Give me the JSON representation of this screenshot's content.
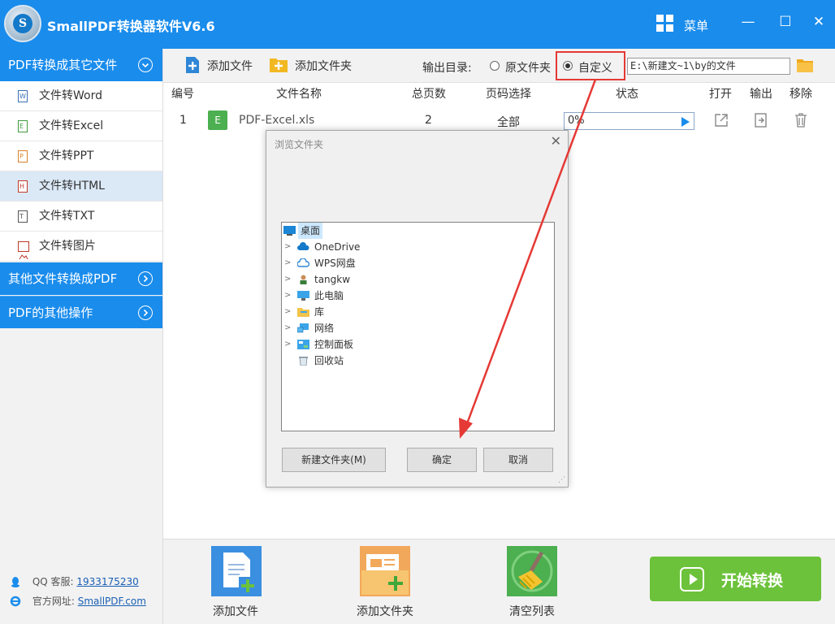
{
  "app": {
    "logo_letter": "S",
    "title": "SmallPDF转换器软件V6.6",
    "menu_label": "菜单",
    "window_controls": {
      "minimize": "—",
      "maximize": "☐",
      "close": "✕"
    }
  },
  "sidebar": {
    "group_main": "PDF转换成其它文件",
    "items": [
      {
        "label": "文件转Word",
        "icon_letter": "W",
        "active": false
      },
      {
        "label": "文件转Excel",
        "icon_letter": "E",
        "active": false
      },
      {
        "label": "文件转PPT",
        "icon_letter": "P",
        "active": false
      },
      {
        "label": "文件转HTML",
        "icon_letter": "H",
        "active": true
      },
      {
        "label": "文件转TXT",
        "icon_letter": "T",
        "active": false
      },
      {
        "label": "文件转图片",
        "icon_letter": "",
        "active": false
      }
    ],
    "group_other": "其他文件转换成PDF",
    "group_ops": "PDF的其他操作",
    "contact": {
      "qq_label": "QQ 客服:",
      "qq_value": "1933175230",
      "site_label": "官方网址:",
      "site_value": "SmallPDF.com"
    }
  },
  "toolbar": {
    "add_file": "添加文件",
    "add_folder": "添加文件夹",
    "output_label": "输出目录:",
    "option_source": "原文件夹",
    "option_custom": "自定义",
    "selected_option": "自定义",
    "output_path": "E:\\新建文~1\\by的文件"
  },
  "table": {
    "headers": {
      "index": "编号",
      "name": "文件名称",
      "pages": "总页数",
      "range": "页码选择",
      "status": "状态",
      "open": "打开",
      "output": "输出",
      "remove": "移除"
    },
    "rows": [
      {
        "index": "1",
        "type_letter": "E",
        "name": "PDF-Excel.xls",
        "pages": "2",
        "range": "全部",
        "progress_text": "0%",
        "progress": 0
      }
    ]
  },
  "bottom": {
    "add_file": "添加文件",
    "add_folder": "添加文件夹",
    "clear_list": "清空列表",
    "start": "开始转换"
  },
  "dialog": {
    "title": "浏览文件夹",
    "close": "✕",
    "tree": [
      {
        "label": "桌面",
        "icon": "desktop-icon",
        "expandable": false,
        "selected": true
      },
      {
        "label": "OneDrive",
        "icon": "onedrive-cloud-icon",
        "expandable": true
      },
      {
        "label": "WPS网盘",
        "icon": "wps-cloud-icon",
        "expandable": true
      },
      {
        "label": "tangkw",
        "icon": "user-icon",
        "expandable": true
      },
      {
        "label": "此电脑",
        "icon": "computer-icon",
        "expandable": true
      },
      {
        "label": "库",
        "icon": "library-folder-icon",
        "expandable": true
      },
      {
        "label": "网络",
        "icon": "network-icon",
        "expandable": true
      },
      {
        "label": "控制面板",
        "icon": "control-panel-icon",
        "expandable": true
      },
      {
        "label": "回收站",
        "icon": "recycle-bin-icon",
        "expandable": false
      }
    ],
    "new_folder": "新建文件夹(M)",
    "ok": "确定",
    "cancel": "取消"
  },
  "colors": {
    "brand_blue": "#1a8cec",
    "start_green": "#6cc23a",
    "highlight_red": "#e53935",
    "active_item": "#dbe9f7"
  }
}
